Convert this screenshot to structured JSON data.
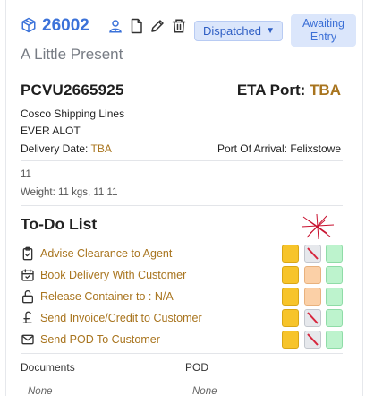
{
  "header": {
    "icons": [
      "package-icon",
      "user-badge-icon",
      "document-icon",
      "pencil-icon",
      "trash-icon"
    ],
    "reference": "26002",
    "status": "Dispatched",
    "badge_line1": "Awaiting",
    "badge_line2": "Entry",
    "subtitle": "A Little Present"
  },
  "shipment": {
    "container": "PCVU2665925",
    "eta_label": "ETA Port:",
    "eta_value": "TBA",
    "carrier": "Cosco Shipping Lines",
    "vessel": "EVER ALOT",
    "delivery_label": "Delivery Date:",
    "delivery_value": "TBA",
    "arrival_label": "Port Of Arrival:",
    "arrival_value": "Felixstowe",
    "count": "11",
    "weight": "Weight: 11 kgs, 11 11"
  },
  "todo": {
    "title": "To-Do List",
    "items": [
      {
        "label": "Advise Clearance to Agent",
        "icon": "clipboard-check-icon",
        "states": [
          "yellow",
          "grey-slash",
          "green"
        ]
      },
      {
        "label": "Book Delivery With Customer",
        "icon": "calendar-check-icon",
        "states": [
          "yellow",
          "peach",
          "green"
        ]
      },
      {
        "label": "Release Container to : N/A",
        "icon": "unlock-icon",
        "states": [
          "yellow",
          "peach",
          "green"
        ]
      },
      {
        "label": "Send Invoice/Credit to Customer",
        "icon": "pound-icon",
        "states": [
          "yellow",
          "grey-slash",
          "green"
        ]
      },
      {
        "label": "Send POD To Customer",
        "icon": "envelope-icon",
        "states": [
          "yellow",
          "grey-slash",
          "green"
        ]
      }
    ]
  },
  "footer": {
    "documents_label": "Documents",
    "documents_value": "None",
    "pod_label": "POD",
    "pod_value": "None"
  },
  "colors": {
    "accent_blue": "#3b72d9",
    "tba_gold": "#a8741e",
    "yellow": "#f7c42a",
    "green": "#bdf3cd",
    "peach": "#fbd0a7",
    "slash_red": "#d7263d"
  }
}
